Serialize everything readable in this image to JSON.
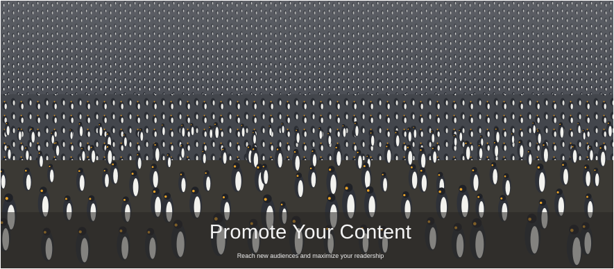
{
  "banner": {
    "title": "Promote Your Content",
    "subtitle": "Reach new audiences and maximize your readership"
  },
  "colors": {
    "caption_text": "#f4f4f4",
    "caption_band": "#282624",
    "penguin_body": "#2e3138",
    "penguin_belly": "#f2f2ee",
    "penguin_accent": "#e8a22a"
  }
}
